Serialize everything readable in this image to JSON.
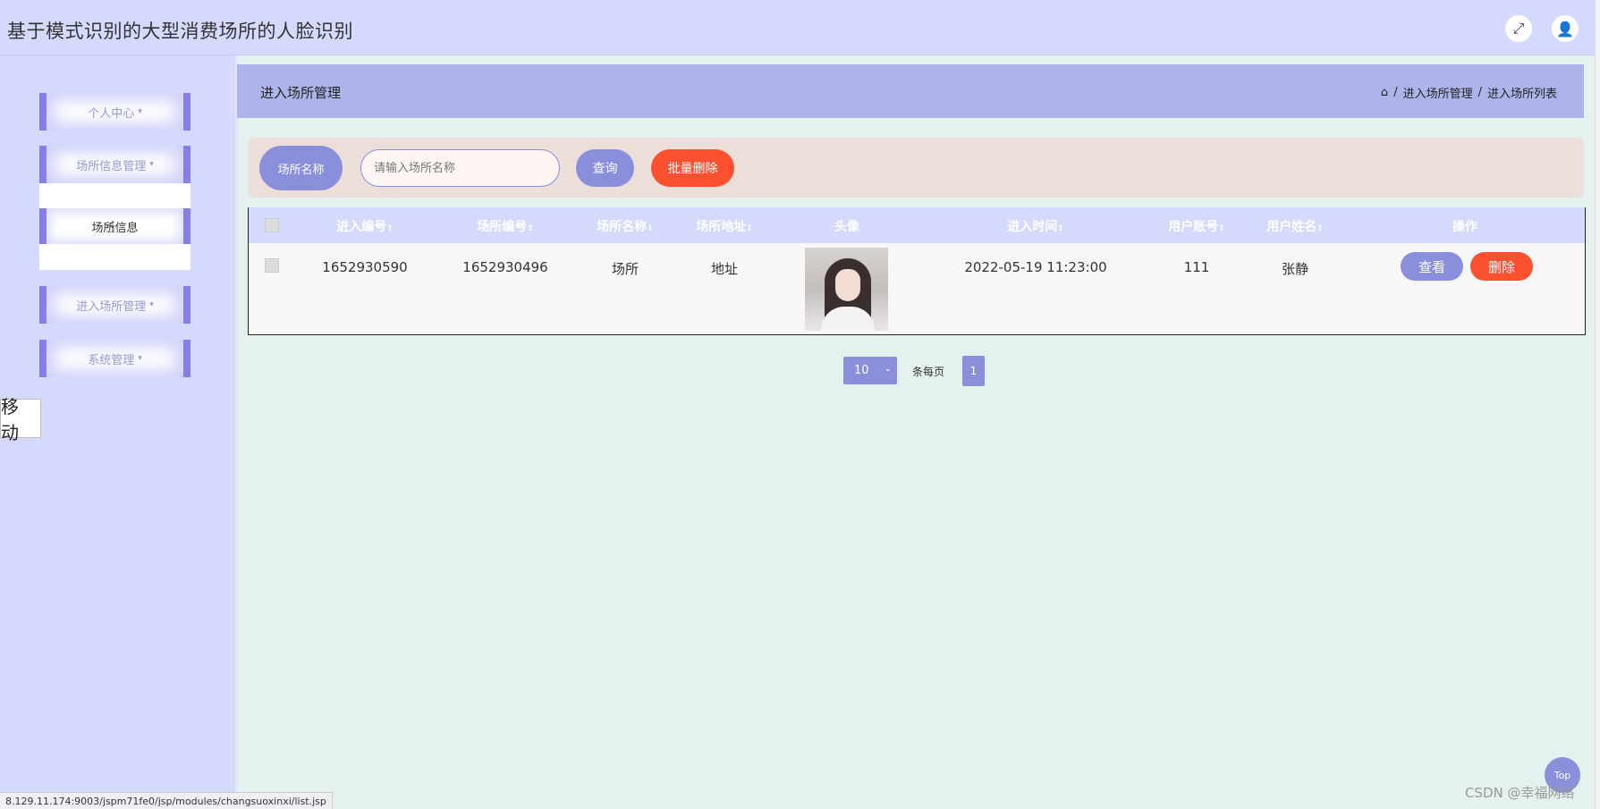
{
  "header": {
    "title": "基于模式识别的大型消费场所的人脸识别",
    "expand_icon": "⤢",
    "user_icon": "👤"
  },
  "sidebar": {
    "menus": [
      {
        "label": "个人中心"
      },
      {
        "label": "场所信息管理"
      },
      {
        "label": "进入场所管理"
      },
      {
        "label": "系统管理"
      }
    ],
    "submenu_active": "场所信息",
    "drag_text": "移动",
    "caret": "▾"
  },
  "page": {
    "title": "进入场所管理",
    "breadcrumb": [
      "进入场所管理",
      "进入场所列表"
    ],
    "breadcrumb_sep": "/"
  },
  "search": {
    "label": "场所名称",
    "placeholder": "请输入场所名称",
    "query_btn": "查询",
    "batch_delete_btn": "批量删除"
  },
  "table": {
    "columns": [
      "进入编号",
      "场所编号",
      "场所名称",
      "场所地址",
      "头像",
      "进入时间",
      "用户账号",
      "用户姓名",
      "操作"
    ],
    "sort_mark": "⇕",
    "rows": [
      {
        "entry_no": "1652930590",
        "place_no": "1652930496",
        "place_name": "场所",
        "place_address": "地址",
        "entry_time": "2022-05-19 11:23:00",
        "user_account": "111",
        "user_name": "张静",
        "view_btn": "查看",
        "delete_btn": "删除"
      }
    ]
  },
  "pagination": {
    "page_size": "10",
    "per_page_label": "条每页",
    "current_page": "1"
  },
  "misc": {
    "top_btn": "Top",
    "watermark": "CSDN @幸福网络",
    "status_url": "8.129.11.174:9003/jspm71fe0/jsp/modules/changsuoxinxi/list.jsp"
  },
  "colors": {
    "accent": "#8a8fdb",
    "danger": "#fb5130",
    "header_bg": "#d4d9fd",
    "page_header_bg": "#adb4e9"
  }
}
